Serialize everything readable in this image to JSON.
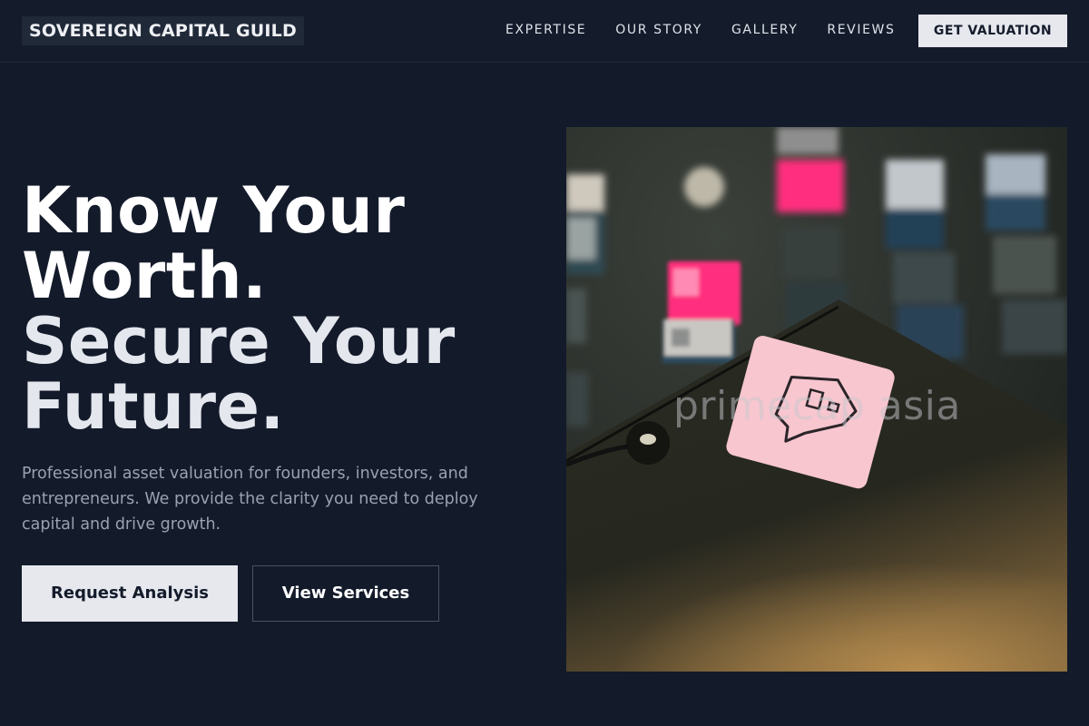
{
  "header": {
    "brand": "SOVEREIGN CAPITAL GUILD",
    "nav": [
      "EXPERTISE",
      "OUR STORY",
      "GALLERY",
      "REVIEWS"
    ],
    "cta": "GET VALUATION"
  },
  "hero": {
    "title_line1": "Know Your",
    "title_line2": "Worth.",
    "title_line3": "Secure Your",
    "title_line4": "Future.",
    "subtitle": "Professional asset valuation for founders, investors, and entrepreneurs. We provide the clarity you need to deploy capital and drive growth.",
    "primary_button": "Request Analysis",
    "secondary_button": "View Services",
    "image_watermark": "primecap asia"
  },
  "colors": {
    "background": "#131a2a",
    "button_light": "#e6e8ee",
    "accent_pink": "#ff3d7f"
  }
}
